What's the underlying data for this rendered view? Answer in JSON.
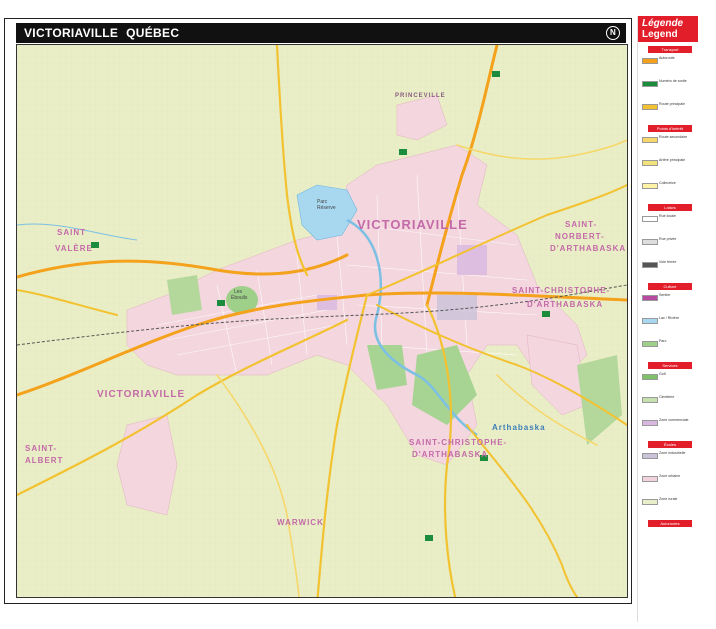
{
  "title": {
    "city": "VICTORIAVILLE",
    "province": "QUÉBEC"
  },
  "places": {
    "victoriaville_center": "VICTORIAVILLE",
    "victoriaville_west": "VICTORIAVILLE",
    "princeville": "PRINCEVILLE",
    "saint": "SAINT",
    "valere": "VALÈRE",
    "saint_norbert": "SAINT-",
    "saint_norbert2": "NORBERT-",
    "darthabaska": "D'ARTHABASKA",
    "saint_christophe_east": "SAINT-CHRISTOPHE-",
    "darthabaska_east": "D'ARTHABASKA",
    "saint_albert": "SAINT-",
    "albert": "ALBERT",
    "saint_christophe_south": "SAINT-CHRISTOPHE-",
    "darthabaska_south": "D'ARTHABASKA",
    "arthabaska": "Arthabaska",
    "warwick": "WARWICK",
    "les_ebouils": "Les",
    "les_ebouils2": "Ébouils",
    "parc": "Parc",
    "parc2": "Réserve"
  },
  "legend": {
    "title_fr": "Légende",
    "title_en": "Legend",
    "sections": [
      "Transport",
      "Points d'intérêt",
      "Loisirs",
      "Culture",
      "Services",
      "Écoles",
      "Autoroutes"
    ],
    "rows": [
      {
        "label": "Autoroute",
        "color": "#f4a21c"
      },
      {
        "label": "Numéro de sortie",
        "color": "#1a8c3c"
      },
      {
        "label": "Route principale",
        "color": "#f2c230"
      },
      {
        "label": "Route secondaire",
        "color": "#f6d76a"
      },
      {
        "label": "Artère principale",
        "color": "#f1e27a"
      },
      {
        "label": "Collectrice",
        "color": "#fff3a8"
      },
      {
        "label": "Rue locale",
        "color": "#ffffff"
      },
      {
        "label": "Rue privée",
        "color": "#dddddd"
      },
      {
        "label": "Voie ferrée",
        "color": "#555555"
      },
      {
        "label": "Sentier",
        "color": "#b84aa0"
      },
      {
        "label": "Lac / Rivière",
        "color": "#a8d8f0"
      },
      {
        "label": "Parc",
        "color": "#9fd08a"
      },
      {
        "label": "Golf",
        "color": "#7fc06a"
      },
      {
        "label": "Cimetière",
        "color": "#c7e0b0"
      },
      {
        "label": "Zone commerciale",
        "color": "#d8b8e0"
      },
      {
        "label": "Zone industrielle",
        "color": "#c9c2d8"
      },
      {
        "label": "Zone urbaine",
        "color": "#f2d2dc"
      },
      {
        "label": "Zone rurale",
        "color": "#e8eec8"
      }
    ]
  }
}
